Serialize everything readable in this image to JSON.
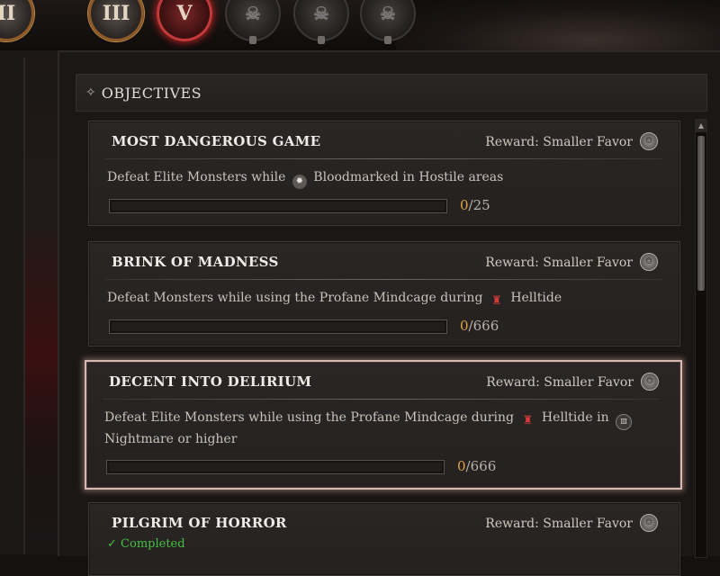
{
  "top_bar": {
    "emblems": [
      {
        "numeral": "II",
        "state": "bronze"
      },
      {
        "numeral": "III",
        "state": "bronze"
      },
      {
        "numeral": "V",
        "state": "active"
      },
      {
        "numeral": "",
        "state": "locked"
      },
      {
        "numeral": "",
        "state": "locked"
      },
      {
        "numeral": "",
        "state": "locked"
      }
    ]
  },
  "panel": {
    "header_icon": "✧",
    "title": "OBJECTIVES"
  },
  "objectives": [
    {
      "title": "MOST DANGEROUS GAME",
      "reward": "Reward: Smaller Favor",
      "desc_parts": [
        "Defeat Elite Monsters while",
        "Bloodmarked in Hostile areas"
      ],
      "inline_icons": [
        "bloodmark-icon"
      ],
      "progress_current": "0",
      "progress_total": "/25",
      "progress_fraction": 0
    },
    {
      "title": "BRINK OF MADNESS",
      "reward": "Reward: Smaller Favor",
      "desc_parts": [
        "Defeat Monsters while using the Profane Mindcage during",
        "Helltide"
      ],
      "inline_icons": [
        "helltide-icon"
      ],
      "progress_current": "0",
      "progress_total": "/666",
      "progress_fraction": 0
    },
    {
      "title": "DECENT INTO DELIRIUM",
      "reward": "Reward: Smaller Favor",
      "desc_parts": [
        "Defeat Elite Monsters while using the Profane Mindcage during",
        "Helltide in",
        "Nightmare or higher"
      ],
      "inline_icons": [
        "helltide-icon",
        "nightmare-icon"
      ],
      "progress_current": "0",
      "progress_total": "/666",
      "progress_fraction": 0
    },
    {
      "title": "PILGRIM OF HORROR",
      "reward": "Reward: Smaller Favor",
      "status": "Completed",
      "status_icon": "✓"
    }
  ],
  "colors": {
    "progress_current": "#e0a446",
    "completed": "#46c041",
    "highlight_border": "#d8b8b2"
  }
}
